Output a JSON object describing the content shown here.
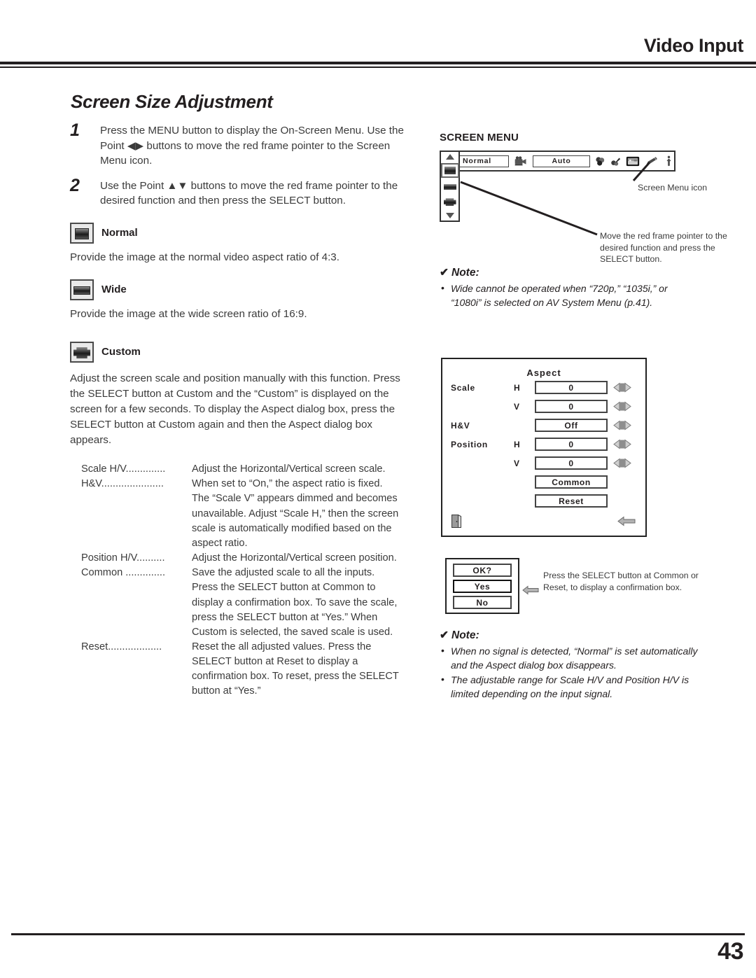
{
  "header": {
    "title": "Video Input"
  },
  "section": {
    "title": "Screen Size Adjustment"
  },
  "steps": [
    {
      "number": "1",
      "text": "Press the MENU button to display the On-Screen Menu. Use the Point ◀▶ buttons to move the red frame pointer to the Screen Menu icon."
    },
    {
      "number": "2",
      "text": "Use the Point ▲▼ buttons to move the red frame pointer to the desired function and then press the SELECT button."
    }
  ],
  "modes": [
    {
      "label": "Normal",
      "icon": "screen-normal-icon",
      "description": "Provide the image at the normal video aspect ratio of 4:3."
    },
    {
      "label": "Wide",
      "icon": "screen-wide-icon",
      "description": "Provide the image at the wide screen ratio of 16:9."
    },
    {
      "label": "Custom",
      "icon": "screen-custom-icon",
      "description": ""
    }
  ],
  "custom_body": "Adjust the screen scale and position manually with this function. Press the SELECT button at Custom and the “Custom” is displayed on the screen for a few seconds. To display the Aspect dialog box, press the SELECT button at Custom again and then the Aspect dialog box appears.",
  "definitions": [
    {
      "term": "Scale H/V..............",
      "desc": "Adjust the Horizontal/Vertical screen scale."
    },
    {
      "term": "H&V......................",
      "desc": "When set to “On,” the aspect ratio is fixed."
    },
    {
      "term": "",
      "desc": "The “Scale V” appears dimmed and becomes"
    },
    {
      "term": "",
      "desc": "unavailable. Adjust “Scale H,” then the screen"
    },
    {
      "term": "",
      "desc": "scale is automatically modified based on the"
    },
    {
      "term": "",
      "desc": "aspect ratio."
    },
    {
      "term": "Position H/V..........",
      "desc": "Adjust the Horizontal/Vertical screen position."
    },
    {
      "term": "Common ..............",
      "desc": "Save the adjusted scale to all the inputs."
    },
    {
      "term": "",
      "desc": "Press the SELECT button at Common to"
    },
    {
      "term": "",
      "desc": "display a confirmation box. To save the scale,"
    },
    {
      "term": "",
      "desc": "press the SELECT button at “Yes.” When"
    },
    {
      "term": "",
      "desc": "Custom is selected, the saved scale is used."
    },
    {
      "term": "Reset...................",
      "desc": "Reset the all adjusted values. Press the"
    },
    {
      "term": "",
      "desc": "SELECT button at Reset to display a"
    },
    {
      "term": "",
      "desc": "confirmation box. To reset, press the SELECT"
    },
    {
      "term": "",
      "desc": "button at “Yes.”"
    }
  ],
  "screen_menu": {
    "title": "SCREEN MENU",
    "bar": {
      "value_left": "Normal",
      "value_right": "Auto",
      "icons": [
        "video-camera-icon",
        "color-adjust-icon",
        "image-adjust-icon",
        "screen-size-icon",
        "pencil-icon",
        "setting-icon"
      ]
    },
    "sidebar_items": [
      "scroll-up-arrow",
      "screen-normal-icon",
      "screen-wide-icon",
      "screen-custom-icon",
      "scroll-down-arrow"
    ],
    "callout_icon": "Screen Menu icon",
    "callout_pointer": "Move the red frame pointer to the desired function and press the SELECT button."
  },
  "note_top": {
    "heading": "Note:",
    "check": "✔",
    "items": [
      "Wide cannot be operated when “720p,” “1035i,” or “1080i” is selected on AV System Menu (p.41)."
    ]
  },
  "aspect_dialog": {
    "title": "Aspect",
    "rows": [
      {
        "label": "Scale",
        "sub": "H",
        "value": "0"
      },
      {
        "label": "",
        "sub": "V",
        "value": "0"
      },
      {
        "label": "H&V",
        "sub": "",
        "value": "Off"
      },
      {
        "label": "Position",
        "sub": "H",
        "value": "0"
      },
      {
        "label": "",
        "sub": "V",
        "value": "0"
      }
    ],
    "buttons": [
      {
        "label": "Common"
      },
      {
        "label": "Reset"
      }
    ],
    "exit_icon": "exit-door-icon",
    "back_icon": "back-arrow-icon"
  },
  "confirm_dialog": {
    "title": "OK?",
    "yes": "Yes",
    "no": "No",
    "pointer_icon": "left-arrow-pointer-icon",
    "caption": "Press the SELECT button at Common or Reset, to display a confirmation box."
  },
  "note_bottom": {
    "heading": "Note:",
    "check": "✔",
    "items": [
      "When no signal is detected, “Normal” is set automatically and the Aspect dialog box disappears.",
      "The adjustable range for Scale H/V and Position H/V is limited depending on the input signal."
    ]
  },
  "footer": {
    "page_number": "43"
  },
  "colors": {
    "ink": "#231f20",
    "body_text": "#3b3b3b",
    "rule": "#231f20"
  }
}
